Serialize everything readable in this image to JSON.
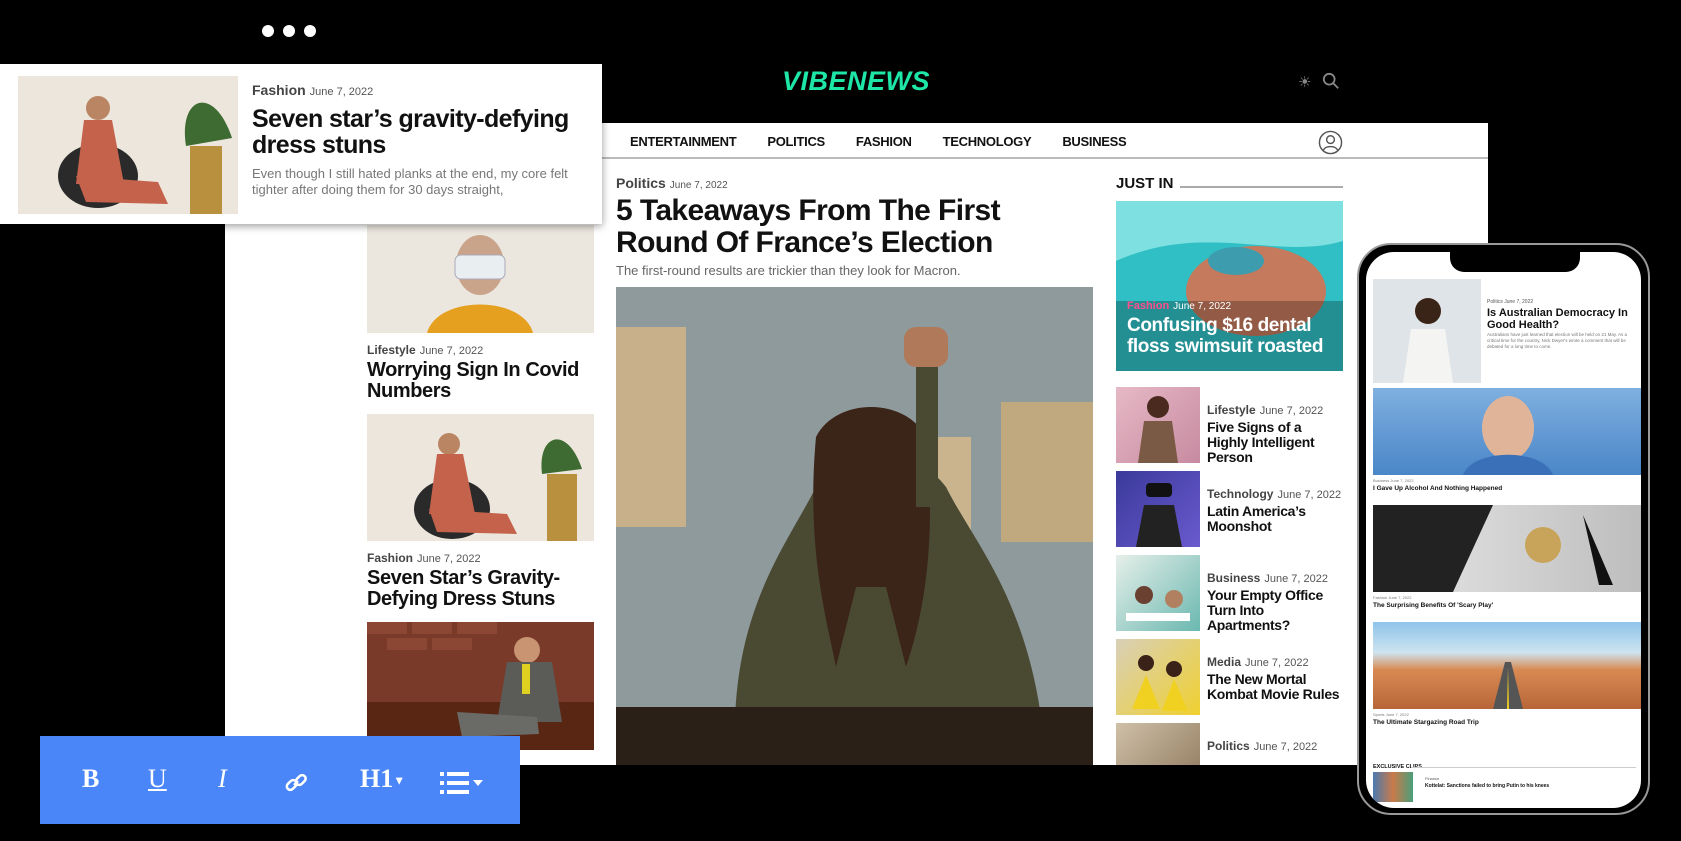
{
  "brand": {
    "logo": "VIBENEWS",
    "accent": "#1ee6a6"
  },
  "nav": {
    "items": [
      "ENTERTAINMENT",
      "POLITICS",
      "FASHION",
      "TECHNOLOGY",
      "BUSINESS"
    ]
  },
  "left_column": [
    {
      "category": "Lifestyle",
      "date": "June 7, 2022",
      "title": "Worrying Sign In Covid Numbers"
    },
    {
      "category": "Fashion",
      "date": "June 7, 2022",
      "title": "Seven Star’s Gravity-Defying Dress Stuns"
    }
  ],
  "main_article": {
    "category": "Politics",
    "date": "June 7, 2022",
    "title": "5 Takeaways From The First Round Of France’s Election",
    "subtitle": "The first-round results are trickier than they look for Macron."
  },
  "just_in": {
    "heading": "JUST IN",
    "featured": {
      "category": "Fashion",
      "date": "June 7, 2022",
      "title": "Confusing $16 dental floss swimsuit roasted",
      "category_color": "#ff4f8b"
    },
    "items": [
      {
        "category": "Lifestyle",
        "date": "June 7, 2022",
        "title": "Five Signs of a Highly Intelligent Person"
      },
      {
        "category": "Technology",
        "date": "June 7, 2022",
        "title": "Latin America’s Moonshot"
      },
      {
        "category": "Business",
        "date": "June 7, 2022",
        "title": "Your Empty Office Turn Into Apartments?"
      },
      {
        "category": "Media",
        "date": "June 7, 2022",
        "title": "The New Mortal Kombat Movie Rules"
      },
      {
        "category": "Politics",
        "date": "June 7, 2022",
        "title": ""
      }
    ]
  },
  "floating_card": {
    "category": "Fashion",
    "date": "June 7, 2022",
    "title": "Seven star’s gravity-defying dress stuns",
    "description": "Even though I still hated planks at the end, my core felt tighter after doing them for 30 days straight,"
  },
  "toolbar": {
    "bold": "B",
    "underline": "U",
    "italic": "I",
    "link_icon": "link-icon",
    "heading": "H1",
    "list_icon": "list-icon",
    "color": "#4a86f7"
  },
  "phone": {
    "top_story": {
      "category": "Politics",
      "date": "June 7, 2022",
      "title": "Is Australian Democracy In Good Health?",
      "description": "Australians have just learned that election will be held on 21 May. As a critical time for the country, Nick Dwyer's wrote a comment that will be debated for a long time to come."
    },
    "stories": [
      {
        "category": "Business",
        "date": "June 7, 2022",
        "title": "I Gave Up Alcohol And Nothing Happened"
      },
      {
        "category": "Fashion",
        "date": "June 7, 2022",
        "title": "The Surprising Benefits Of 'Scary Play'"
      },
      {
        "category": "Sports",
        "date": "June 7, 2022",
        "title": "The Ultimate Stargazing Road Trip"
      }
    ],
    "clips": {
      "heading": "EXCLUSIVE CLIPS",
      "category": "Finance",
      "title": "Kottelat: Sanctions failed to bring Putin to his knees"
    }
  }
}
